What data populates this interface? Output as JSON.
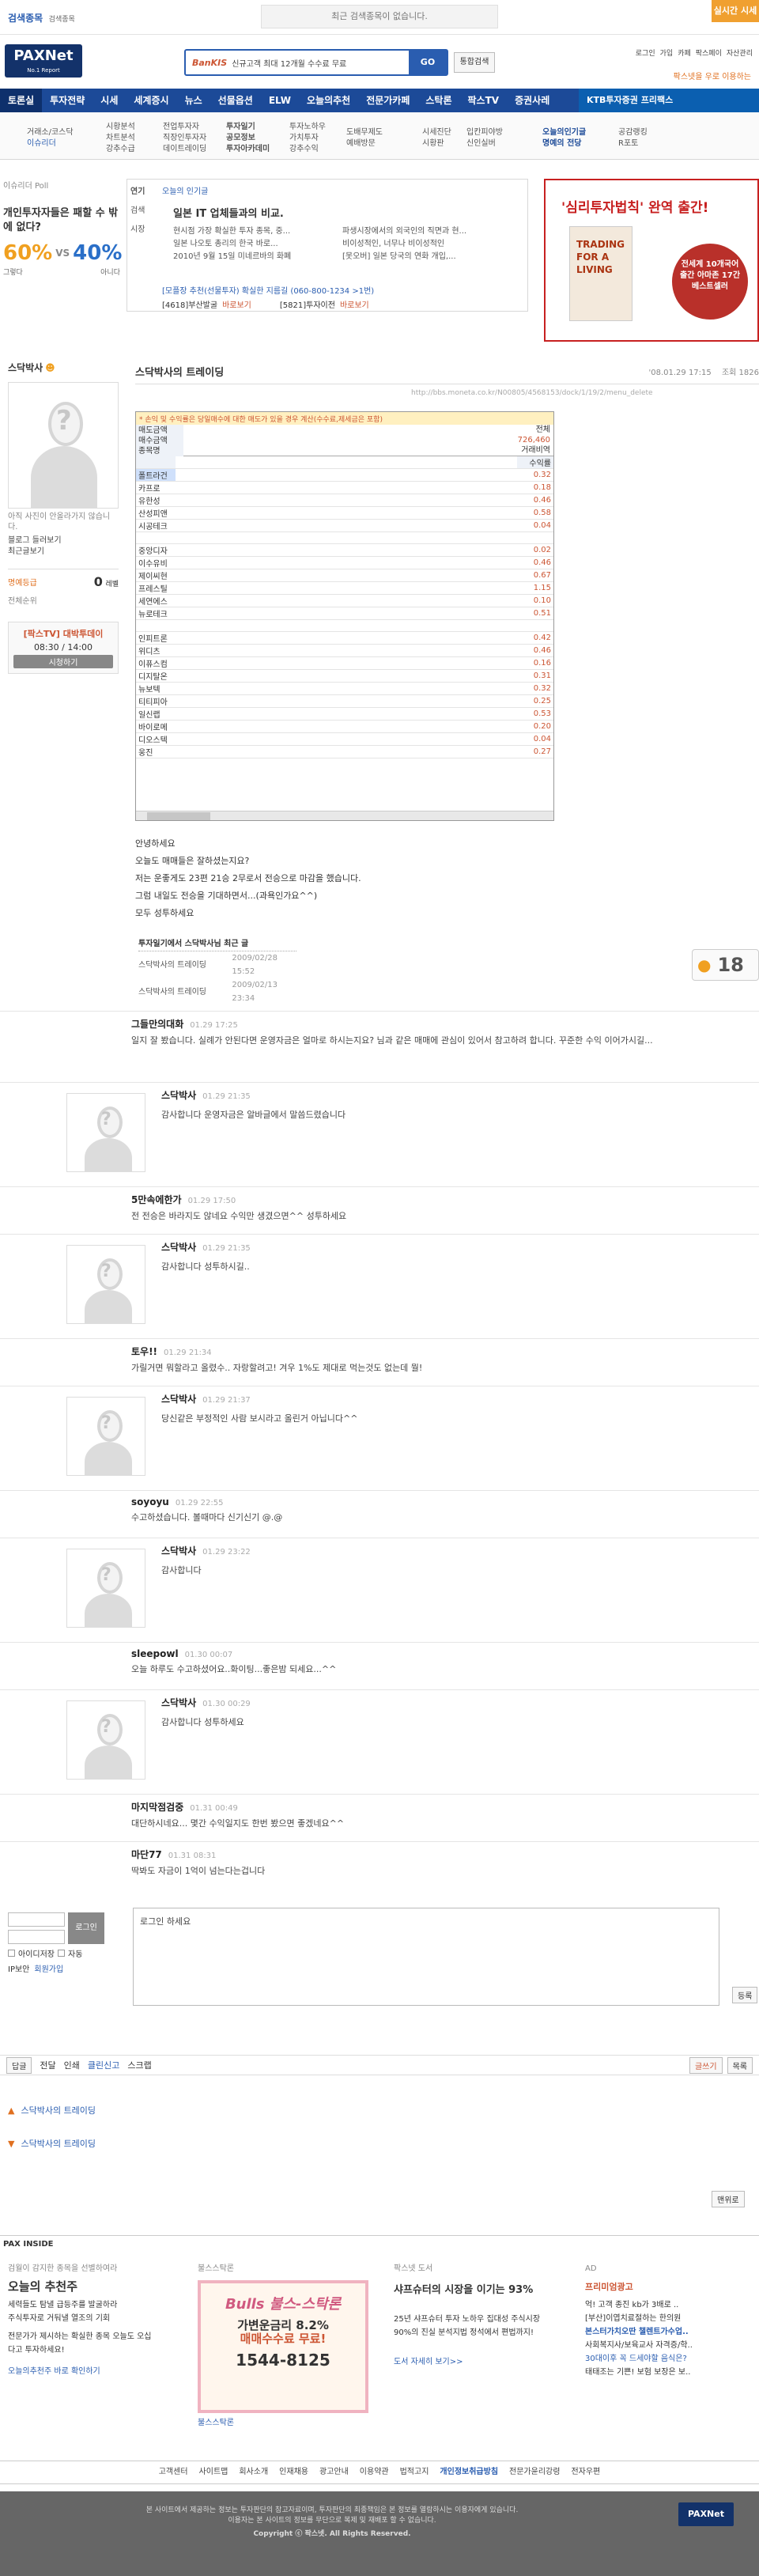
{
  "top": {
    "left_label": "검색종목",
    "left_sub": "검색종목",
    "history_msg": "최근 검색종목이 없습니다.",
    "pay_btn": "실시간 시세"
  },
  "logo": {
    "name": "PAXNet",
    "tag": "No.1 Report"
  },
  "search": {
    "brand": "BanKIS",
    "ad": "신규고객 최대 12개월 수수료 무료",
    "go": "GO",
    "unified": "통합검색"
  },
  "util": {
    "items": [
      "로그인",
      "가입",
      "카페",
      "팍스페이",
      "자산관리"
    ],
    "promo": "팍스넷을 우로 이용하는"
  },
  "gnb": {
    "items": [
      "토론실",
      "투자전략",
      "시세",
      "세계증시",
      "뉴스",
      "선물옵션",
      "ELW",
      "오늘의추천",
      "전문가카페",
      "스탁론",
      "팍스TV",
      "증권사레",
      "KTB투자증권 프리팩스"
    ]
  },
  "subnav": {
    "cols": [
      [
        "거래소/코스닥",
        "이슈리더"
      ],
      [
        "시황분석",
        "차트분석",
        "강추수급"
      ],
      [
        "전업투자자",
        "직장인투자자",
        "데이트레이딩"
      ],
      [
        "투자일기",
        "공모정보",
        "투자아카데미"
      ],
      [
        "투자노하우",
        "가치투자",
        "강추수익"
      ],
      [
        "도배무제도",
        "예배방문"
      ],
      [
        "시세진단",
        "시황판"
      ],
      [
        "입칸피야방",
        "신인실버"
      ],
      [
        "오늘의인기글",
        "명예의 전당"
      ],
      [
        "공감랭킹",
        "R포토"
      ]
    ]
  },
  "left_poll": {
    "label": "이슈리더 Poll",
    "question": "개인투자자들은 패할 수 밖에 없다?",
    "pct_a": "60%",
    "vs": "VS",
    "pct_b": "40%",
    "a_label": "그렇다",
    "b_label": "아니다"
  },
  "popular": {
    "title": "오늘의 인기글",
    "side": [
      "연기",
      "검색",
      "시장"
    ],
    "headline": "일본 IT 업체들과의 비교.",
    "items": [
      "현시점 가장 확실한 투자 종목, 중...",
      "일본 나오토 총리의 한국 바로...",
      "2010년 9월 15일 미네르바의 화폐"
    ],
    "items_r": [
      "파생시장에서의 외국인의 직면과 현...",
      "비이성적인, 너무나 비이성적인",
      "[못오버] 일본 당국의 연화 개입,..."
    ]
  },
  "ticker": {
    "phone": "[모플장 추천(선물투자) 확실한 지름길 (060-800-1234 >1번)",
    "a": "[4618]부산발굴",
    "b": "[5821]투자이전",
    "btn": "바로보기"
  },
  "book": {
    "title": "'심리투자법칙' 완역 출간!",
    "cover": "TRADING FOR A LIVING",
    "circle": "전세계 10개국어출간 아마존 17간 베스트셀러"
  },
  "author": {
    "section": "스닥박사",
    "note": "아직 사진이 안올라가지 않습니다.",
    "links": [
      "블로그 들러보기",
      "최근글보기"
    ],
    "grade_label": "명예등급",
    "grade_val": "0",
    "grade_unit": "레벨",
    "rank_label": "전체순위",
    "tv": "[팍스TV] 대박투데이",
    "tv_time": "08:30 / 14:00",
    "tv_btn": "시청하기"
  },
  "post": {
    "title": "스닥박사의 트레이딩",
    "date": "'08.01.29 17:15",
    "views_label": "조회",
    "views": "1826",
    "url": "http://bbs.moneta.co.kr/N00805/4568153/dock/1/19/2/menu_delete"
  },
  "table": {
    "notice": "* 손익 및 수익률은 당일매수에 대한 매도가 있을 경우 계산(수수료,제세금은 포함)",
    "hdr": [
      "매도금액",
      "매수금액",
      "종목명"
    ],
    "total_label": "전체",
    "total_val": "726,460",
    "rate_label": "거래비역",
    "col_rate": "수익률",
    "rows": [
      [
        "폴트라건",
        "0.32"
      ],
      [
        "카프로",
        "0.18"
      ],
      [
        "유한성",
        "0.46"
      ],
      [
        "산성피앤",
        "0.58"
      ],
      [
        "시공테크",
        "0.04"
      ],
      [
        "",
        ""
      ],
      [
        "중앙디자",
        "0.02"
      ],
      [
        "이수유비",
        "0.46"
      ],
      [
        "제이씨현",
        "0.67"
      ],
      [
        "프레스틸",
        "1.15"
      ],
      [
        "세연에스",
        "0.10"
      ],
      [
        "뉴로테크",
        "0.51"
      ],
      [
        "",
        ""
      ],
      [
        "인피트론",
        "0.42"
      ],
      [
        "위디츠",
        "0.46"
      ],
      [
        "이퓨스컴",
        "0.16"
      ],
      [
        "디지탈온",
        "0.31"
      ],
      [
        "뉴보텍",
        "0.32"
      ],
      [
        "티티피아",
        "0.25"
      ],
      [
        "일신랩",
        "0.53"
      ],
      [
        "바이로메",
        "0.20"
      ],
      [
        "디오스텍",
        "0.04"
      ],
      [
        "웅진",
        "0.27"
      ]
    ]
  },
  "body": {
    "lines": [
      "안녕하세요",
      "오늘도 매매들은 잘하셨는지요?",
      "저는 운좋게도 23편 21승 2무로서 전승으로 마감을 했습니다.",
      "그럼 내일도 전승을 기대하면서...(과욕인가요^^)",
      "모두 성투하세요"
    ],
    "related_title": "투자일기에서 스닥박사님 최근 글",
    "related": [
      [
        "스닥박사의 트레이딩",
        "2009/02/28 15:52"
      ],
      [
        "스닥박사의 트레이딩",
        "2009/02/13 23:34"
      ]
    ],
    "like": "18"
  },
  "comments": [
    {
      "name": "그들만의대화",
      "time": "01.29 17:25",
      "text": "일지 잘 봤습니다. 실례가 안된다면 운영자금은 얼마로 하시는지요? 님과 같은 매매에 관심이 있어서 참고하려 합니다. 꾸준한 수익 이어가시길..."
    },
    {
      "name": "스닥박사",
      "time": "01.29 21:35",
      "text": "감사합니다 운영자금은 알바글에서 말씀드렸습니다",
      "reply": true
    },
    {
      "name": "5만속에한가",
      "time": "01.29 17:50",
      "text": "전 전승은 바라지도 않네요 수익만 생겼으면^^ 성투하세요"
    },
    {
      "name": "스닥박사",
      "time": "01.29 21:35",
      "text": "감사합니다 성투하시길..",
      "reply": true
    },
    {
      "name": "토우!!",
      "time": "01.29 21:34",
      "text": "가릴거면 뭐할라고 올렸수.. 자랑할려고! 겨우 1%도 제대로 먹는것도 없는데 뭘!"
    },
    {
      "name": "스닥박사",
      "time": "01.29 21:37",
      "text": "당신같은 부정적인 사람 보시라고 올린거 아닙니다^^",
      "reply": true
    },
    {
      "name": "soyoyu",
      "time": "01.29 22:55",
      "text": "수고하셨습니다. 볼때마다 신기신기 @.@"
    },
    {
      "name": "스닥박사",
      "time": "01.29 23:22",
      "text": "감사합니다",
      "reply": true
    },
    {
      "name": "sleepowl",
      "time": "01.30 00:07",
      "text": "오늘 하루도 수고하셨어요..화이팅...좋은밤 되세요...^^"
    },
    {
      "name": "스닥박사",
      "time": "01.30 00:29",
      "text": "감사합니다 성투하세요",
      "reply": true
    },
    {
      "name": "마지막점검중",
      "time": "01.31 00:49",
      "text": "대단하시네요... 몇간 수익일지도 한번 봤으면 좋겠네요^^"
    },
    {
      "name": "마단77",
      "time": "01.31 08:31",
      "text": "딱봐도 자금이 1억이 넘는다는겁니다"
    }
  ],
  "login": {
    "btn": "로그인",
    "save_id": "아이디저장",
    "auto": "자동",
    "ip": "IP보안",
    "join": "회원가입",
    "prompt": "로그인 하세요",
    "submit": "등록"
  },
  "actions": {
    "items": [
      "답글",
      "전달",
      "인쇄",
      "클린신고",
      "스크랩"
    ],
    "right": [
      "글쓰기",
      "목록"
    ]
  },
  "nav": {
    "prev": "스닥박사의 트레이딩",
    "next": "스닥박사의 트레이딩",
    "top": "맨위로"
  },
  "inside": {
    "title": "PAX INSIDE",
    "c1_head": "검월이 감지한 종목을 선별하여라",
    "c1_title": "오늘의 추천주",
    "c1_items": [
      "세력들도 탐낼 급등주를 발굴하라",
      "주식투자로 거둬낼 열조의 기회",
      "전문가가 제시하는 확실한 종목 오늘도 오십다고 투자하세요!"
    ],
    "c1_link": "오늘의추천주 바로 확인하기",
    "c2_head": "불스스탁론",
    "c2_brand": "Bulls 불스-스탁론",
    "c2_rate": "가변운금리 8.2%",
    "c2_free": "매매수수료 무료!",
    "c2_tel": "1544-8125",
    "c2_link": "불스스탁론",
    "c3_head": "팍스넷 도서",
    "c3_title": "샤프슈터의 시장을 이기는 93%",
    "c3_text": "25년 샤프슈터 투자 노하우 집대성 주식시장 90%의 진실 분석지법 정석에서 편법까지!",
    "c3_link": "도서 자세히 보기>>",
    "c4_head": "AD",
    "c4_title": "프리미엄광고",
    "c4_items": [
      "억! 고객 종진 kb가 3배로 ..",
      "[부산]이엽치료절하는 한의원",
      "본스터가치오딴 챌렌트가수업..",
      "사회복지사/보육교사 자격증/학..",
      "30대이후 꼭 드세야할 음식은?",
      "태태조는 기쁜! 보험 보장은 보.."
    ]
  },
  "footer_links": [
    "고객센터",
    "사이트맵",
    "회사소개",
    "인재채용",
    "광고안내",
    "이용약관",
    "법적고지",
    "개인정보취급방침",
    "전문가윤리강령",
    "전자우편"
  ],
  "footer": {
    "line1": "본 사이트에서 제공하는 정보는 투자판단의 참고자료이며, 투자판단의 최종책임은 본 정보를 열람하시는 이용자에게 있습니다.",
    "line2": "이용자는 본 사이트의 정보를 무단으로 복제 및 재배포 할 수 없습니다.",
    "copy": "Copyright ⓒ 팍스넷. All Rights Reserved."
  }
}
